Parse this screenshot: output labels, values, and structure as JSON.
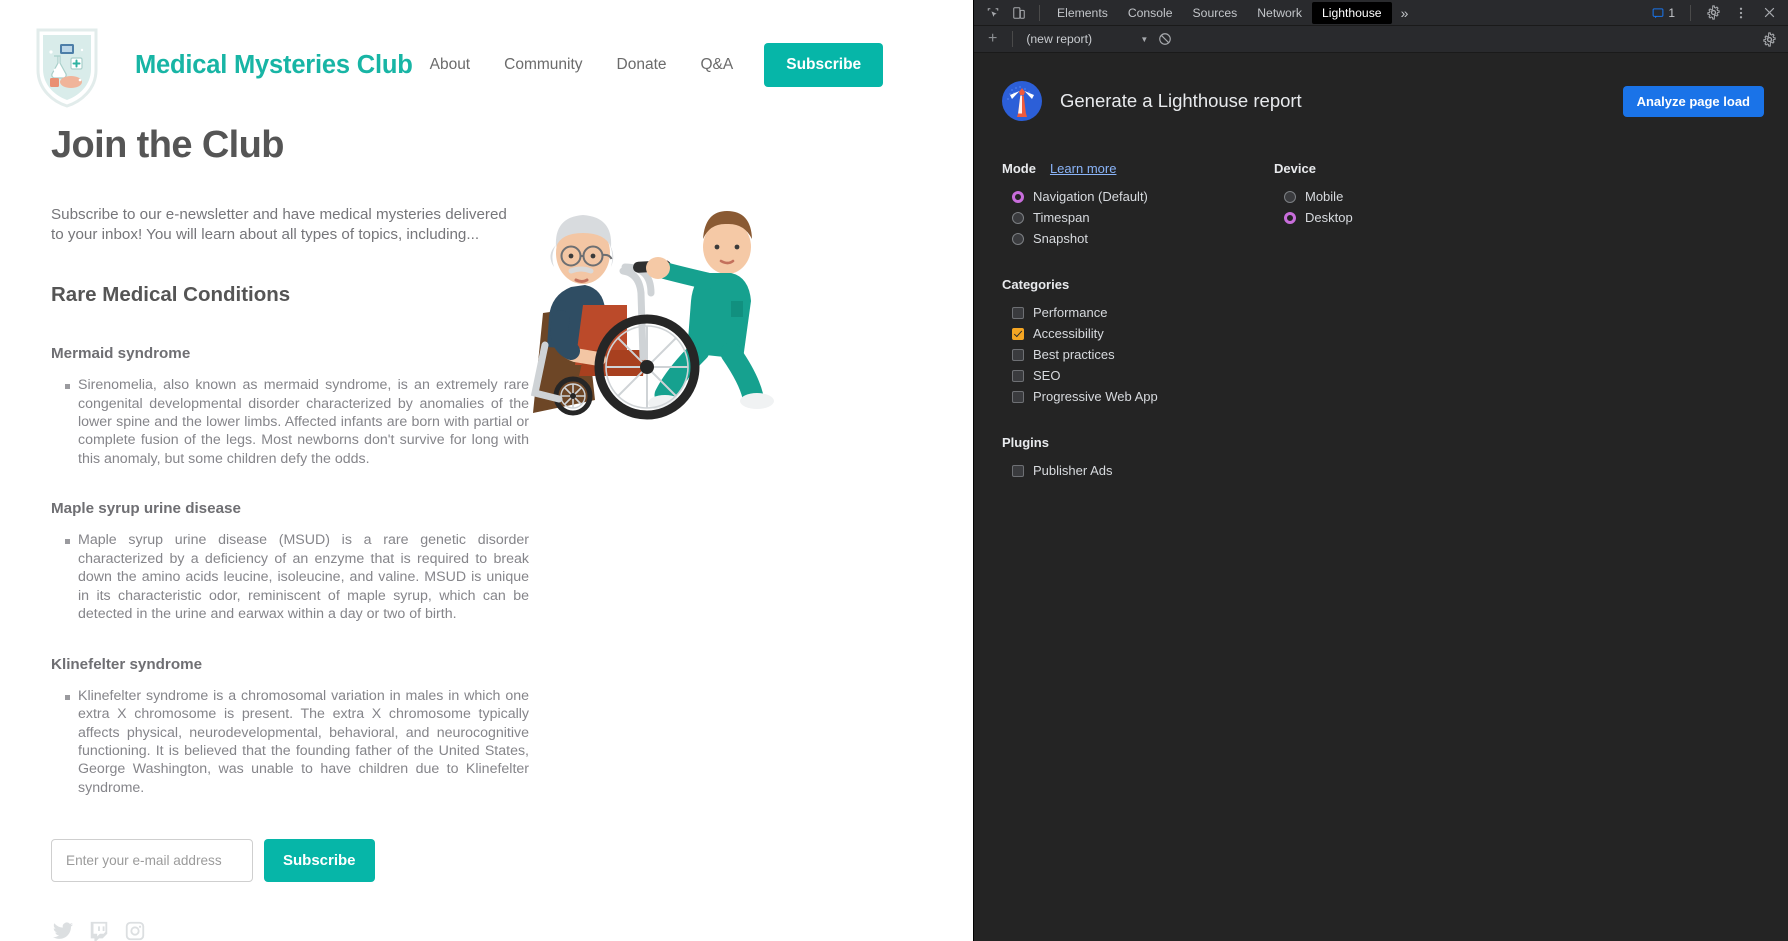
{
  "site": {
    "brand": "Medical Mysteries Club",
    "logo_alt": "medical-shield-logo",
    "nav": [
      {
        "label": "About"
      },
      {
        "label": "Community"
      },
      {
        "label": "Donate"
      },
      {
        "label": "Q&A"
      }
    ],
    "nav_cta": "Subscribe",
    "accent_color": "#06b6a8",
    "brand_color": "#18b5a5"
  },
  "main": {
    "title": "Join the Club",
    "lede": "Subscribe to our e-newsletter and have medical mysteries delivered to your inbox! You will learn about all types of topics, including...",
    "section_title": "Rare Medical Conditions",
    "conditions": [
      {
        "name": "Mermaid syndrome",
        "body": "Sirenomelia, also known as mermaid syndrome, is an extremely rare congenital developmental disorder characterized by anomalies of the lower spine and the lower limbs. Affected infants are born with partial or complete fusion of the legs. Most newborns don't survive for long with this anomaly, but some children defy the odds."
      },
      {
        "name": "Maple syrup urine disease",
        "body": "Maple syrup urine disease (MSUD) is a rare genetic disorder characterized by a deficiency of an enzyme that is required to break down the amino acids leucine, isoleucine, and valine. MSUD is unique in its characteristic odor, reminiscent of maple syrup, which can be detected in the urine and earwax within a day or two of birth."
      },
      {
        "name": "Klinefelter syndrome",
        "body": "Klinefelter syndrome is a chromosomal variation in males in which one extra X chromosome is present. The extra X chromosome typically affects physical, neurodevelopmental, behavioral, and neurocognitive functioning. It is believed that the founding father of the United States, George Washington, was unable to have children due to Klinefelter syndrome."
      }
    ],
    "illustration_alt": "nurse-pushing-patient-in-wheelchair-illustration"
  },
  "subscribe_form": {
    "email_placeholder": "Enter your e-mail address",
    "email_value": "",
    "button_label": "Subscribe"
  },
  "socials": [
    {
      "name": "twitter-icon"
    },
    {
      "name": "twitch-icon"
    },
    {
      "name": "instagram-icon"
    }
  ],
  "devtools": {
    "tabs": [
      {
        "label": "Elements",
        "active": false
      },
      {
        "label": "Console",
        "active": false
      },
      {
        "label": "Sources",
        "active": false
      },
      {
        "label": "Network",
        "active": false
      },
      {
        "label": "Lighthouse",
        "active": true
      }
    ],
    "more_tabs": "»",
    "message_count": "1",
    "subbar": {
      "new_report_label": "(new report)"
    }
  },
  "lighthouse": {
    "title": "Generate a Lighthouse report",
    "analyze_button": "Analyze page load",
    "mode": {
      "label": "Mode",
      "learn_more": "Learn more",
      "options": [
        {
          "label": "Navigation (Default)",
          "checked": true
        },
        {
          "label": "Timespan",
          "checked": false
        },
        {
          "label": "Snapshot",
          "checked": false
        }
      ]
    },
    "device": {
      "label": "Device",
      "options": [
        {
          "label": "Mobile",
          "checked": false
        },
        {
          "label": "Desktop",
          "checked": true
        }
      ]
    },
    "categories": {
      "label": "Categories",
      "options": [
        {
          "label": "Performance",
          "checked": false
        },
        {
          "label": "Accessibility",
          "checked": true
        },
        {
          "label": "Best practices",
          "checked": false
        },
        {
          "label": "SEO",
          "checked": false
        },
        {
          "label": "Progressive Web App",
          "checked": false
        }
      ]
    },
    "plugins": {
      "label": "Plugins",
      "options": [
        {
          "label": "Publisher Ads",
          "checked": false
        }
      ]
    },
    "accent_radio": "#c86ddb",
    "accent_check": "#f5a623",
    "accent_button": "#1a73e8"
  }
}
